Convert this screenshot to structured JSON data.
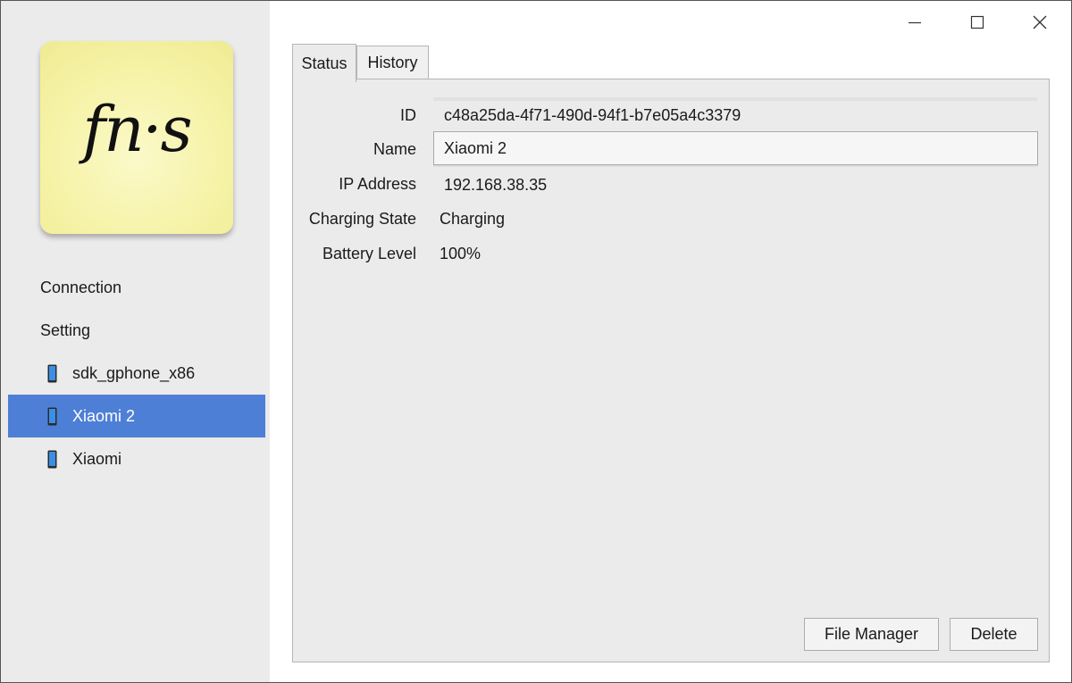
{
  "sidebar": {
    "logo_text": "fn·s",
    "items": [
      {
        "label": "Connection",
        "type": "menu"
      },
      {
        "label": "Setting",
        "type": "menu"
      },
      {
        "label": "sdk_gphone_x86",
        "type": "device"
      },
      {
        "label": "Xiaomi 2",
        "type": "device",
        "selected": true
      },
      {
        "label": "Xiaomi",
        "type": "device"
      }
    ]
  },
  "window_controls": [
    "minimize-icon",
    "maximize-icon",
    "close-icon"
  ],
  "tabs": [
    {
      "label": "Status",
      "active": true
    },
    {
      "label": "History",
      "active": false
    }
  ],
  "status": {
    "id_label": "ID",
    "id_value": "c48a25da-4f71-490d-94f1-b7e05a4c3379",
    "name_label": "Name",
    "name_value": "Xiaomi 2",
    "ip_label": "IP Address",
    "ip_value": "192.168.38.35",
    "charging_label": "Charging State",
    "charging_value": "Charging",
    "battery_label": "Battery Level",
    "battery_value": "100%"
  },
  "buttons": {
    "file_manager": "File Manager",
    "delete": "Delete"
  },
  "colors": {
    "selection": "#4e7fd6",
    "sidebar_bg": "#ebebeb",
    "logo_bg": "#f6f3a8"
  }
}
